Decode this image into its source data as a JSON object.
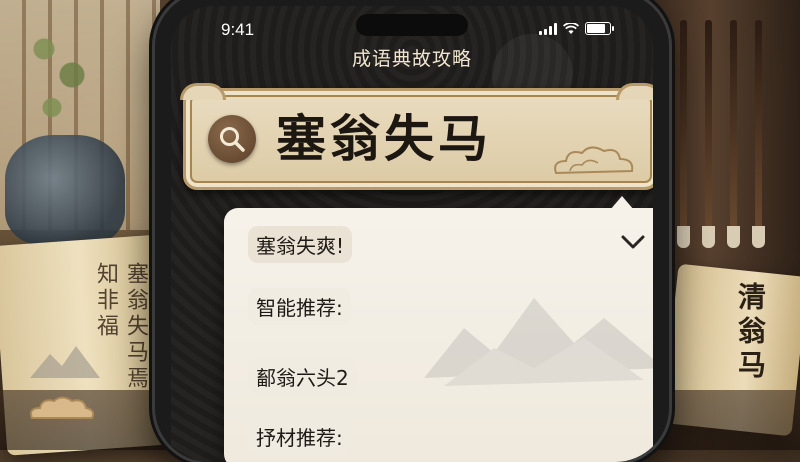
{
  "status_bar": {
    "time": "9:41"
  },
  "app": {
    "title": "成语典故攻略"
  },
  "search": {
    "query": "塞翁失马"
  },
  "dropdown": {
    "rows": [
      {
        "label": "塞翁失爽!"
      },
      {
        "label": "智能推荐:"
      },
      {
        "label": "鄐翁六头2"
      },
      {
        "label": "抒材推荐:"
      }
    ]
  },
  "background": {
    "scroll_left_text": "塞翁失马焉知非福",
    "scroll_right_text": "清翁马"
  },
  "colors": {
    "accent": "#b89a6a",
    "screen_bg": "#1f1d1b",
    "dropdown_bg": "#f6f2ea",
    "title_text": "#f1e6d0"
  },
  "icons": [
    "search-icon",
    "chevron-down-icon",
    "signal-icon",
    "wifi-icon",
    "battery-icon",
    "cloud-icon"
  ]
}
